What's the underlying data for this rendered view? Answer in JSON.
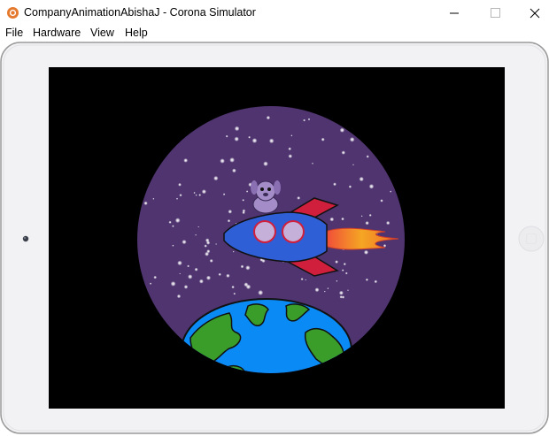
{
  "window": {
    "title": "CompanyAnimationAbishaJ - Corona Simulator",
    "icon": "corona-simulator-icon",
    "controls": {
      "minimize_icon": "minimize-icon",
      "maximize_icon": "maximize-icon",
      "close_icon": "close-icon"
    }
  },
  "menubar": {
    "items": [
      {
        "label": "File"
      },
      {
        "label": "Hardware"
      },
      {
        "label": "View"
      },
      {
        "label": "Help"
      }
    ]
  },
  "device": {
    "type": "tablet",
    "orientation": "landscape",
    "frame_color": "#f2f2f4",
    "screen_bg": "#000000"
  },
  "scene": {
    "space_color": "#4f3470",
    "earth_ocean": "#0a8af5",
    "earth_land": "#3a9d2a",
    "rocket_body": "#2f5fd6",
    "rocket_fins": "#d01f3c",
    "windows": "#c4b0d8",
    "flame": "#f5a623",
    "dog": "#a48cc8"
  }
}
